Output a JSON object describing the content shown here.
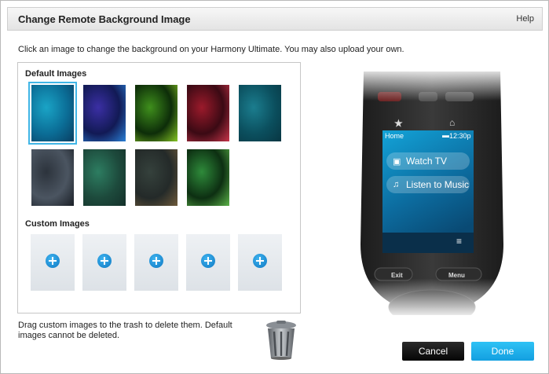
{
  "dialog": {
    "title": "Change Remote Background Image",
    "help_label": "Help",
    "instructions": "Click an image to change the background on your Harmony Ultimate. You may also upload your own."
  },
  "default_images": {
    "label": "Default Images",
    "selected_index": 0,
    "items": [
      {
        "name": "teal-gradient",
        "colors": [
          "#0b6d96",
          "#1aa4c6",
          "#0a3e62"
        ]
      },
      {
        "name": "aurora-blue",
        "colors": [
          "#121a55",
          "#3b2fa4",
          "#2a80d6"
        ]
      },
      {
        "name": "green-glow",
        "colors": [
          "#0d2d09",
          "#3f8f1c",
          "#86c524"
        ]
      },
      {
        "name": "red-bokeh",
        "colors": [
          "#3b0a14",
          "#9b1a2b",
          "#c8354a"
        ]
      },
      {
        "name": "teal-vignette",
        "colors": [
          "#0b4f5e",
          "#1b7d8e",
          "#083642"
        ]
      },
      {
        "name": "dark-slate",
        "colors": [
          "#4b5561",
          "#2c333c",
          "#1a1f26"
        ]
      },
      {
        "name": "green-lines",
        "colors": [
          "#1d4a3c",
          "#2d7d61",
          "#14302a"
        ]
      },
      {
        "name": "koi-pond",
        "colors": [
          "#242a29",
          "#35413c",
          "#6e5a3a"
        ]
      },
      {
        "name": "lily-pad",
        "colors": [
          "#0d2f12",
          "#2e8a3a",
          "#5bb248"
        ]
      }
    ]
  },
  "custom_images": {
    "label": "Custom Images",
    "slots": 5
  },
  "footer_note": "Drag custom images to the trash to delete them. Default images cannot be deleted.",
  "buttons": {
    "cancel": "Cancel",
    "done": "Done"
  },
  "remote": {
    "screen_title": "Home",
    "time": "12:30p",
    "menu_items": [
      {
        "label": "Watch TV",
        "icon": "tv-icon"
      },
      {
        "label": "Listen to Music",
        "icon": "music-note-icon"
      }
    ],
    "exit_label": "Exit",
    "menu_label": "Menu"
  }
}
